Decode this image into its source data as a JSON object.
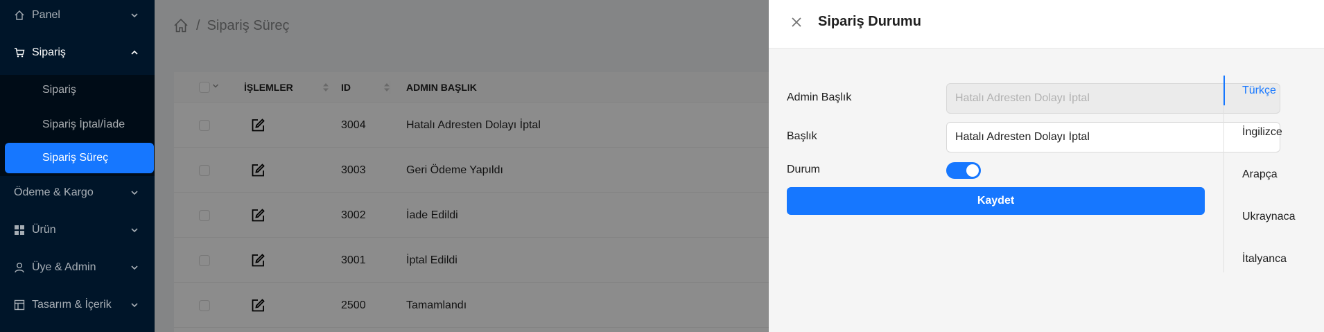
{
  "sidebar": {
    "items": [
      {
        "label": "Panel",
        "icon": "home-icon"
      },
      {
        "label": "Sipariş",
        "icon": "cart-icon"
      },
      {
        "label": "Ödeme & Kargo",
        "icon": ""
      },
      {
        "label": "Ürün",
        "icon": "grid-icon"
      },
      {
        "label": "Üye & Admin",
        "icon": "user-icon"
      },
      {
        "label": "Tasarım & İçerik",
        "icon": "layout-icon"
      }
    ],
    "submenu": [
      {
        "label": "Sipariş"
      },
      {
        "label": "Sipariş İptal/İade"
      },
      {
        "label": "Sipariş Süreç"
      }
    ]
  },
  "breadcrumb": {
    "current": "Sipariş Süreç",
    "separator": "/"
  },
  "table": {
    "columns": [
      "İŞLEMLER",
      "ID",
      "ADMIN BAŞLIK"
    ],
    "rows": [
      {
        "id": "3004",
        "admin_title": "Hatalı Adresten Dolayı İptal"
      },
      {
        "id": "3003",
        "admin_title": "Geri Ödeme Yapıldı"
      },
      {
        "id": "3002",
        "admin_title": "İade Edildi"
      },
      {
        "id": "3001",
        "admin_title": "İptal Edildi"
      },
      {
        "id": "2500",
        "admin_title": "Tamamlandı"
      }
    ]
  },
  "drawer": {
    "title": "Sipariş Durumu",
    "form": {
      "admin_title_label": "Admin Başlık",
      "admin_title_value": "Hatalı Adresten Dolayı İptal",
      "title_label": "Başlık",
      "title_value": "Hatalı Adresten Dolayı İptal",
      "status_label": "Durum",
      "status_on": true,
      "save_label": "Kaydet"
    },
    "tabs": [
      "Türkçe",
      "İngilizce",
      "Arapça",
      "Ukraynaca",
      "İtalyanca"
    ],
    "active_tab": "Türkçe"
  },
  "colors": {
    "sidebar_bg": "#001529",
    "accent": "#1677ff",
    "overlay": "rgba(0,0,0,0.45)"
  }
}
